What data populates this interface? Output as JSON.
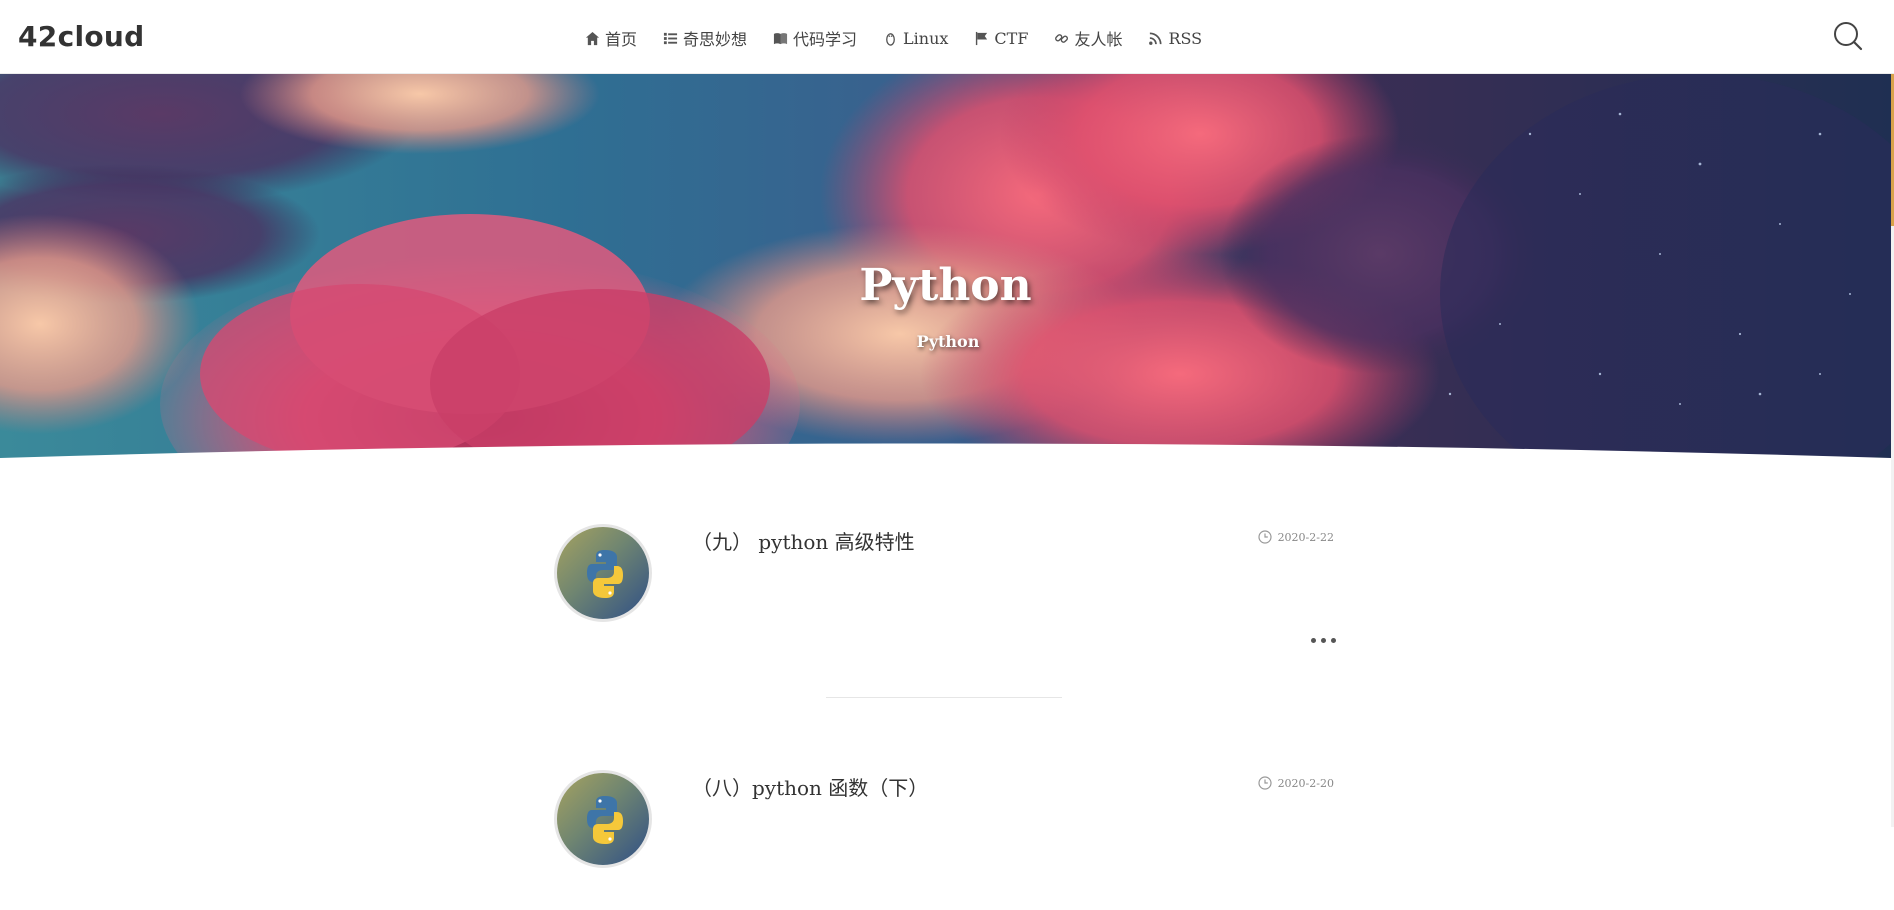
{
  "site": {
    "logo": "42cloud"
  },
  "nav": [
    {
      "label": "首页",
      "icon": "home-icon"
    },
    {
      "label": "奇思妙想",
      "icon": "list-icon"
    },
    {
      "label": "代码学习",
      "icon": "book-icon"
    },
    {
      "label": "Linux",
      "icon": "linux-icon"
    },
    {
      "label": "CTF",
      "icon": "flag-icon"
    },
    {
      "label": "友人帐",
      "icon": "link-icon"
    },
    {
      "label": "RSS",
      "icon": "rss-icon"
    }
  ],
  "hero": {
    "title": "Python",
    "subtitle": "Python"
  },
  "posts": [
    {
      "title": "（九） python 高级特性",
      "date": "2020-2-22"
    },
    {
      "title": "（八）python 函数（下）",
      "date": "2020-2-20"
    }
  ],
  "colors": {
    "accent": "#d8a24a",
    "text": "#333333"
  }
}
